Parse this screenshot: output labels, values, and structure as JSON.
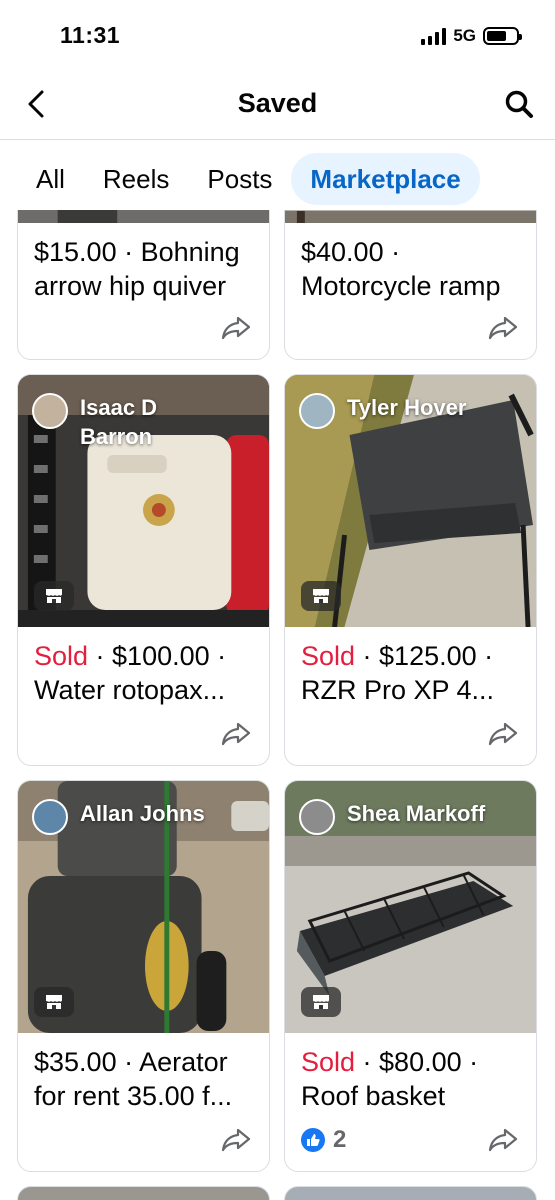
{
  "status_bar": {
    "time": "11:31",
    "network": "5G"
  },
  "header": {
    "title": "Saved"
  },
  "tabs": [
    {
      "label": "All",
      "active": false
    },
    {
      "label": "Reels",
      "active": false
    },
    {
      "label": "Posts",
      "active": false
    },
    {
      "label": "Marketplace",
      "active": true
    }
  ],
  "colors": {
    "accent": "#0866c6",
    "active_tab_bg": "#e7f3ff",
    "sold": "#e41e3f",
    "like": "#1877f2"
  },
  "items": [
    {
      "seller": "",
      "sold": "",
      "price": "$15.00 · Bohning",
      "title_line2": "arrow hip quiver",
      "likes": ""
    },
    {
      "seller": "",
      "sold": "",
      "price": "$40.00 ·",
      "title_line2": "Motorcycle ramp",
      "likes": ""
    },
    {
      "seller": "Isaac D Barron",
      "sold": "Sold",
      "price": " · $100.00 ·",
      "title_line2": "Water rotopax...",
      "likes": ""
    },
    {
      "seller": "Tyler Hover",
      "sold": "Sold",
      "price": " · $125.00 ·",
      "title_line2": "RZR Pro XP 4...",
      "likes": ""
    },
    {
      "seller": "Allan Johns",
      "sold": "",
      "price": "$35.00 · Aerator",
      "title_line2": "for rent 35.00 f...",
      "likes": ""
    },
    {
      "seller": "Shea Markoff",
      "sold": "Sold",
      "price": " · $80.00 ·",
      "title_line2": "Roof basket",
      "likes": "2"
    }
  ],
  "icons": {
    "back": "chevron-left-icon",
    "search": "search-icon",
    "share": "share-arrow-icon",
    "shop": "shop-icon",
    "like": "thumbs-up-icon"
  }
}
